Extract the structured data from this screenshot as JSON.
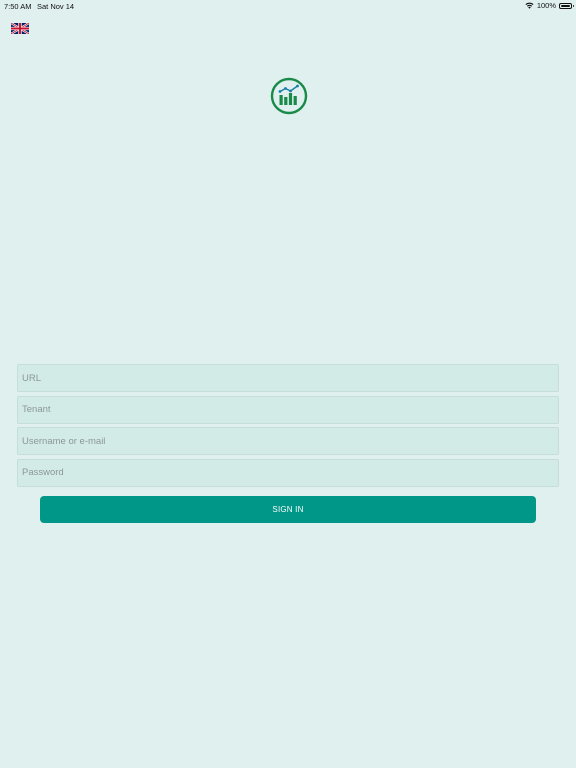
{
  "status_bar": {
    "time": "7:50 AM",
    "date": "Sat Nov 14",
    "battery_percent": "100%",
    "wifi_icon": "wifi-icon",
    "battery_icon": "battery-icon"
  },
  "language": {
    "flag_icon": "uk-flag-icon"
  },
  "logo": {
    "icon": "bar-chart-trend-logo",
    "color": "#1a8a4a"
  },
  "form": {
    "url_placeholder": "URL",
    "url_value": "",
    "tenant_placeholder": "Tenant",
    "tenant_value": "",
    "username_placeholder": "Username or e-mail",
    "username_value": "",
    "password_placeholder": "Password",
    "password_value": ""
  },
  "signin": {
    "label": "SIGN IN",
    "color": "#009688"
  },
  "colors": {
    "background": "#dff0ee",
    "field_background": "#d3ebe7"
  }
}
